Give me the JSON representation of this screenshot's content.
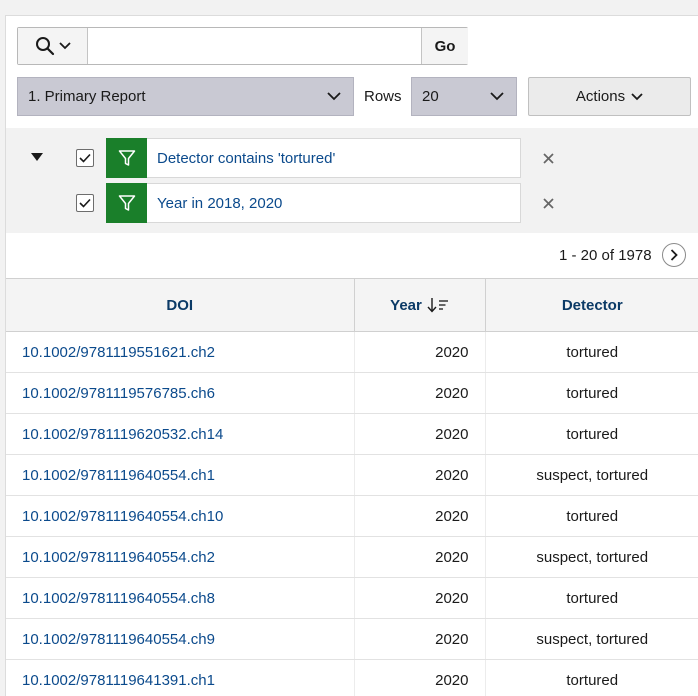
{
  "toolbar": {
    "search_icon": "search-icon",
    "search_value": "",
    "go_label": "Go",
    "report_label": "1. Primary Report",
    "rows_label": "Rows",
    "rows_value": "20",
    "actions_label": "Actions"
  },
  "filters": [
    {
      "text": "Detector contains 'tortured'",
      "checked": true
    },
    {
      "text": "Year in 2018, 2020",
      "checked": true
    }
  ],
  "pagination": {
    "text": "1 - 20 of 1978"
  },
  "table": {
    "columns": [
      "DOI",
      "Year",
      "Detector"
    ],
    "sort": {
      "column": "Year",
      "direction": "desc"
    },
    "rows": [
      {
        "doi": "10.1002/9781119551621.ch2",
        "year": "2020",
        "detector": "tortured"
      },
      {
        "doi": "10.1002/9781119576785.ch6",
        "year": "2020",
        "detector": "tortured"
      },
      {
        "doi": "10.1002/9781119620532.ch14",
        "year": "2020",
        "detector": "tortured"
      },
      {
        "doi": "10.1002/9781119640554.ch1",
        "year": "2020",
        "detector": "suspect, tortured"
      },
      {
        "doi": "10.1002/9781119640554.ch10",
        "year": "2020",
        "detector": "tortured"
      },
      {
        "doi": "10.1002/9781119640554.ch2",
        "year": "2020",
        "detector": "suspect, tortured"
      },
      {
        "doi": "10.1002/9781119640554.ch8",
        "year": "2020",
        "detector": "tortured"
      },
      {
        "doi": "10.1002/9781119640554.ch9",
        "year": "2020",
        "detector": "suspect, tortured"
      },
      {
        "doi": "10.1002/9781119641391.ch1",
        "year": "2020",
        "detector": "tortured"
      }
    ]
  },
  "colors": {
    "link": "#0b4a8c",
    "header_text": "#0b3a66",
    "filter_icon_bg": "#1a7f2a",
    "select_bg": "#c9c9d3"
  }
}
